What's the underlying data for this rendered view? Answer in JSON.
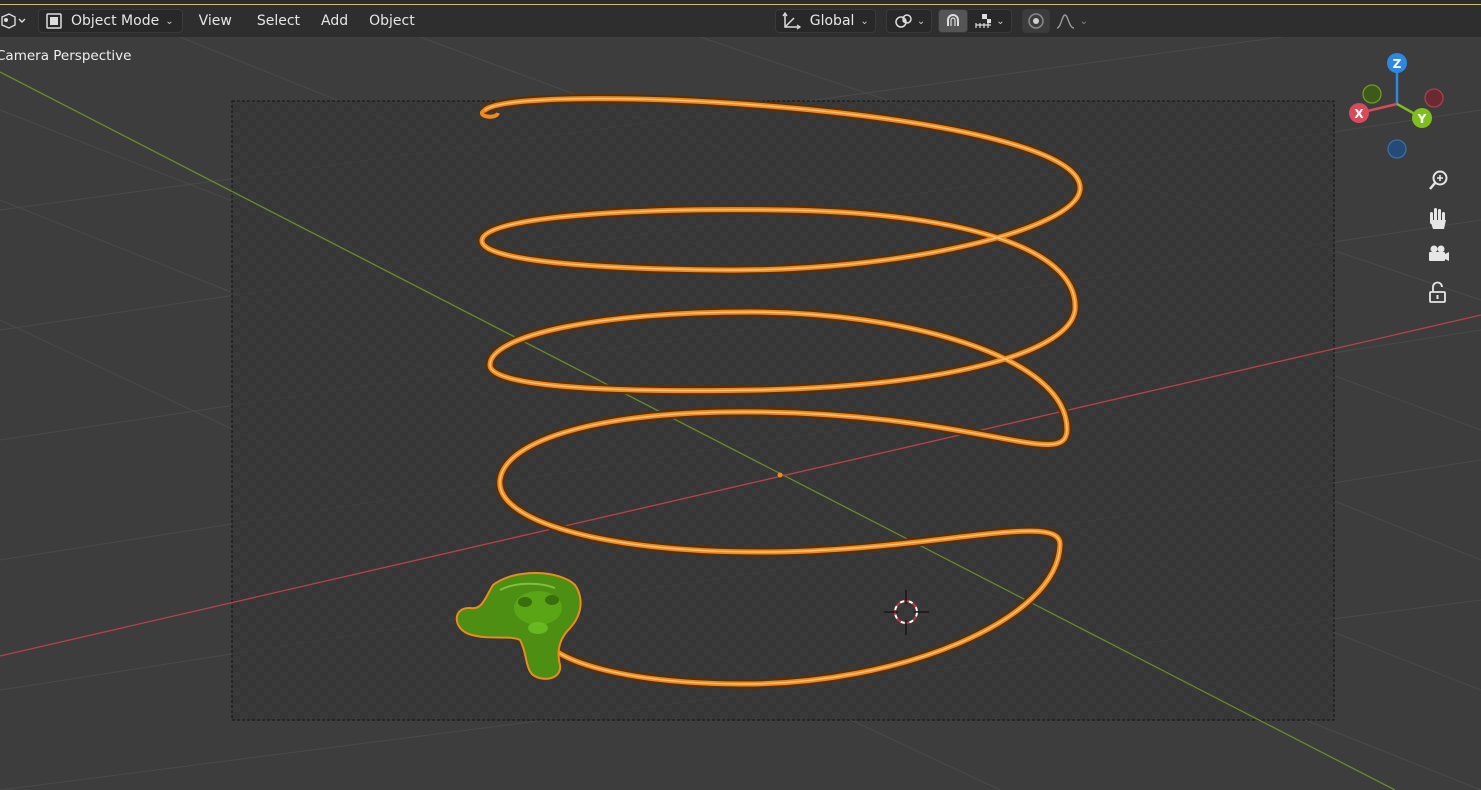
{
  "header": {
    "mode": {
      "label": "Object Mode",
      "icon": "object-mode-icon"
    },
    "menus": [
      "View",
      "Select",
      "Add",
      "Object"
    ],
    "orientation": {
      "label": "Global",
      "icon": "transform-orientation-icon"
    },
    "pivot_icon": "pivot-point-icon",
    "snap_icon": "snap-magnet-icon",
    "snap_target_icon": "snap-increment-icon",
    "proportional_icon": "proportional-editing-icon",
    "falloff_icon": "falloff-curve-icon"
  },
  "viewport": {
    "label": "Camera Perspective",
    "colors": {
      "curve": "#f08a1c",
      "monkey": "#4c8f12",
      "x_axis": "#b8404c",
      "y_axis": "#6a8a2a",
      "background": "#3d3d3d"
    }
  },
  "gizmo": {
    "x": {
      "label": "X",
      "color": "#d94a5a"
    },
    "y": {
      "label": "Y",
      "color": "#7fbf1a"
    },
    "z": {
      "label": "Z",
      "color": "#2e87e0"
    }
  },
  "nav_buttons": [
    "zoom-icon",
    "pan-hand-icon",
    "camera-icon",
    "lock-icon"
  ]
}
